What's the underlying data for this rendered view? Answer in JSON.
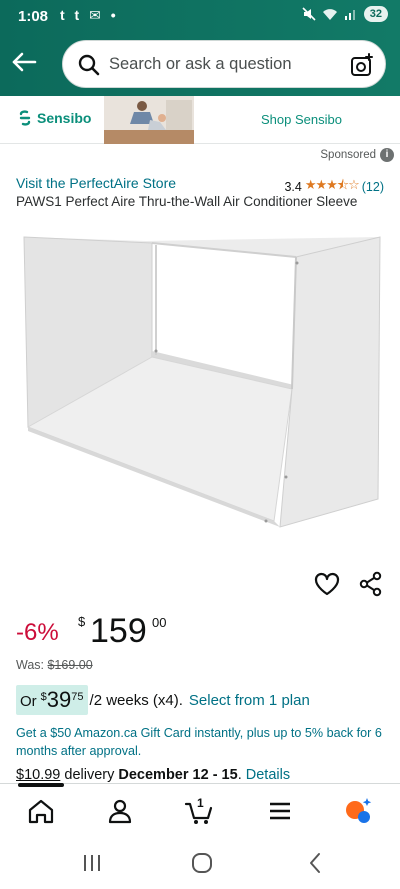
{
  "status_bar": {
    "time": "1:08",
    "notifications": "t t ✉ •",
    "battery": "32"
  },
  "header": {
    "search_placeholder": "Search or ask a question"
  },
  "ad_banner": {
    "brand": "Sensibo",
    "shop_link": "Shop Sensibo",
    "accent_color": "#0b8f7b"
  },
  "sponsored_label": "Sponsored",
  "product": {
    "store_link": "Visit the PerfectAire Store",
    "rating_value": "3.4",
    "rating_stars": 3.5,
    "review_count": "(12)",
    "title": "PAWS1 Perfect Aire Thru-the-Wall Air Conditioner Sleeve",
    "discount": "-6%",
    "price_symbol": "$",
    "price_whole": "159",
    "price_fraction": "00",
    "was_label": "Was: ",
    "was_price": "$169.00",
    "installment_or": "Or",
    "installment_symbol": "$",
    "installment_whole": "39",
    "installment_fraction": "75",
    "installment_term": "/2 weeks (x4).",
    "installment_select": "Select from 1 plan",
    "gift_card_offer": "Get a $50 Amazon.ca Gift Card instantly, plus up to 5% back for 6 months after approval.",
    "delivery_fee": "$10.99",
    "delivery_text": " delivery ",
    "delivery_date": "December 12 - 15",
    "delivery_separator": ". ",
    "delivery_details": "Details"
  },
  "bottom_nav": {
    "cart_count": "1",
    "items": [
      "home-icon",
      "account-icon",
      "cart-icon",
      "menu-icon",
      "rufus-ai-icon"
    ]
  },
  "colors": {
    "header_green": "#0c6a5b",
    "link": "#007185",
    "discount_red": "#cc0c39",
    "star_orange": "#de7921",
    "installment_highlight": "#cfeee8"
  }
}
